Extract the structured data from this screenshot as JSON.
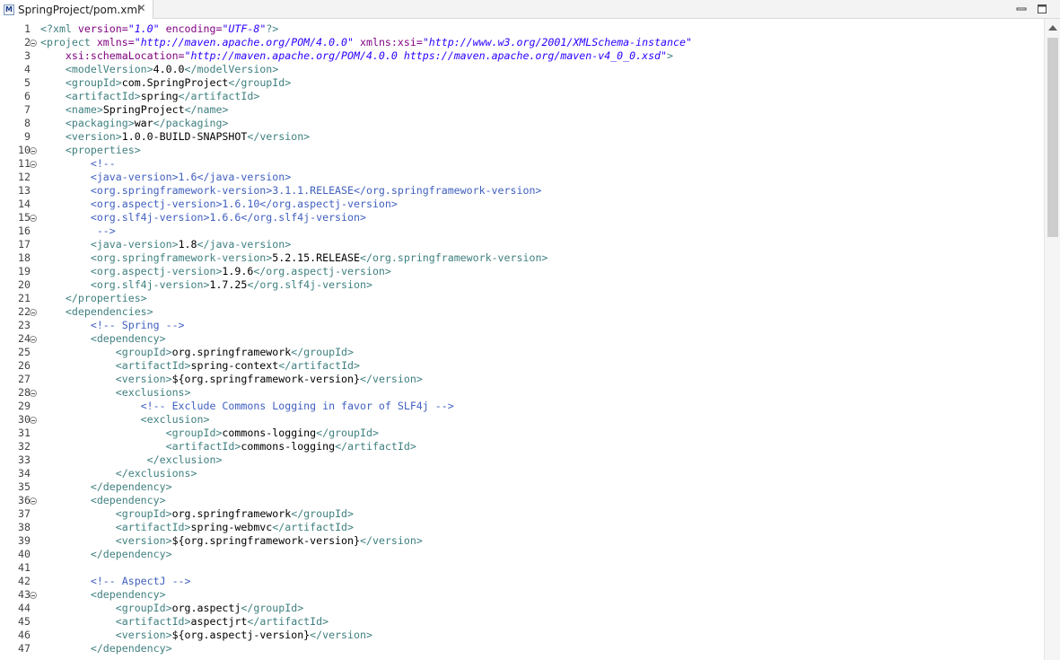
{
  "tab": {
    "title": "SpringProject/pom.xml",
    "icon": "maven-file-icon",
    "icon_text": "M"
  },
  "window_controls": {
    "minimize": "minimize-icon",
    "maximize": "maximize-icon"
  },
  "editor": {
    "lines": [
      {
        "n": 1,
        "segs": [
          [
            "t",
            "<?xml "
          ],
          [
            "a",
            "version="
          ],
          [
            "v",
            "\"1.0\""
          ],
          [
            "a",
            " encoding="
          ],
          [
            "v",
            "\"UTF-8\""
          ],
          [
            "t",
            "?>"
          ]
        ]
      },
      {
        "n": 2,
        "fold": true,
        "segs": [
          [
            "t",
            "<project "
          ],
          [
            "a",
            "xmlns="
          ],
          [
            "v",
            "\"http://maven.apache.org/POM/4.0.0\""
          ],
          [
            "a",
            " xmlns:xsi="
          ],
          [
            "v",
            "\"http://www.w3.org/2001/XMLSchema-instance\""
          ]
        ]
      },
      {
        "n": 3,
        "segs": [
          [
            "a",
            "    xsi:schemaLocation="
          ],
          [
            "v",
            "\"http://maven.apache.org/POM/4.0.0 https://maven.apache.org/maven-v4_0_0.xsd\""
          ],
          [
            "t",
            ">"
          ]
        ]
      },
      {
        "n": 4,
        "segs": [
          [
            "t",
            "    <modelVersion>"
          ],
          [
            "x",
            "4.0.0"
          ],
          [
            "t",
            "</modelVersion>"
          ]
        ]
      },
      {
        "n": 5,
        "segs": [
          [
            "t",
            "    <groupId>"
          ],
          [
            "x",
            "com.SpringProject"
          ],
          [
            "t",
            "</groupId>"
          ]
        ]
      },
      {
        "n": 6,
        "segs": [
          [
            "t",
            "    <artifactId>"
          ],
          [
            "x",
            "spring"
          ],
          [
            "t",
            "</artifactId>"
          ]
        ]
      },
      {
        "n": 7,
        "segs": [
          [
            "t",
            "    <name>"
          ],
          [
            "x",
            "SpringProject"
          ],
          [
            "t",
            "</name>"
          ]
        ]
      },
      {
        "n": 8,
        "segs": [
          [
            "t",
            "    <packaging>"
          ],
          [
            "x",
            "war"
          ],
          [
            "t",
            "</packaging>"
          ]
        ]
      },
      {
        "n": 9,
        "segs": [
          [
            "t",
            "    <version>"
          ],
          [
            "x",
            "1.0.0-BUILD-SNAPSHOT"
          ],
          [
            "t",
            "</version>"
          ]
        ]
      },
      {
        "n": 10,
        "fold": true,
        "segs": [
          [
            "t",
            "    <properties>"
          ]
        ]
      },
      {
        "n": 11,
        "fold": true,
        "segs": [
          [
            "c",
            "        <!--"
          ]
        ]
      },
      {
        "n": 12,
        "segs": [
          [
            "c",
            "        <java-version>1.6</java-version>"
          ]
        ]
      },
      {
        "n": 13,
        "segs": [
          [
            "c",
            "        <org.springframework-version>3.1.1.RELEASE</org.springframework-version>"
          ]
        ]
      },
      {
        "n": 14,
        "segs": [
          [
            "c",
            "        <org.aspectj-version>1.6.10</org.aspectj-version>"
          ]
        ]
      },
      {
        "n": 15,
        "fold": true,
        "segs": [
          [
            "c",
            "        <org.slf4j-version>1.6.6</org.slf4j-version>"
          ]
        ]
      },
      {
        "n": 16,
        "segs": [
          [
            "c",
            "         -->"
          ]
        ]
      },
      {
        "n": 17,
        "segs": [
          [
            "t",
            "        <java-version>"
          ],
          [
            "x",
            "1.8"
          ],
          [
            "t",
            "</java-version>"
          ]
        ]
      },
      {
        "n": 18,
        "segs": [
          [
            "t",
            "        <org.springframework-version>"
          ],
          [
            "x",
            "5.2.15.RELEASE"
          ],
          [
            "t",
            "</org.springframework-version>"
          ]
        ]
      },
      {
        "n": 19,
        "segs": [
          [
            "t",
            "        <org.aspectj-version>"
          ],
          [
            "x",
            "1.9.6"
          ],
          [
            "t",
            "</org.aspectj-version>"
          ]
        ]
      },
      {
        "n": 20,
        "segs": [
          [
            "t",
            "        <org.slf4j-version>"
          ],
          [
            "x",
            "1.7.25"
          ],
          [
            "t",
            "</org.slf4j-version>"
          ]
        ]
      },
      {
        "n": 21,
        "segs": [
          [
            "t",
            "    </properties>"
          ]
        ]
      },
      {
        "n": 22,
        "fold": true,
        "segs": [
          [
            "t",
            "    <dependencies>"
          ]
        ]
      },
      {
        "n": 23,
        "segs": [
          [
            "c",
            "        <!-- Spring -->"
          ]
        ]
      },
      {
        "n": 24,
        "fold": true,
        "segs": [
          [
            "t",
            "        <dependency>"
          ]
        ]
      },
      {
        "n": 25,
        "segs": [
          [
            "t",
            "            <groupId>"
          ],
          [
            "x",
            "org.springframework"
          ],
          [
            "t",
            "</groupId>"
          ]
        ]
      },
      {
        "n": 26,
        "segs": [
          [
            "t",
            "            <artifactId>"
          ],
          [
            "x",
            "spring-context"
          ],
          [
            "t",
            "</artifactId>"
          ]
        ]
      },
      {
        "n": 27,
        "segs": [
          [
            "t",
            "            <version>"
          ],
          [
            "x",
            "${org.springframework-version}"
          ],
          [
            "t",
            "</version>"
          ]
        ]
      },
      {
        "n": 28,
        "fold": true,
        "segs": [
          [
            "t",
            "            <exclusions>"
          ]
        ]
      },
      {
        "n": 29,
        "segs": [
          [
            "c",
            "                <!-- Exclude Commons Logging in favor of SLF4j -->"
          ]
        ]
      },
      {
        "n": 30,
        "fold": true,
        "segs": [
          [
            "t",
            "                <exclusion>"
          ]
        ]
      },
      {
        "n": 31,
        "segs": [
          [
            "t",
            "                    <groupId>"
          ],
          [
            "x",
            "commons-logging"
          ],
          [
            "t",
            "</groupId>"
          ]
        ]
      },
      {
        "n": 32,
        "segs": [
          [
            "t",
            "                    <artifactId>"
          ],
          [
            "x",
            "commons-logging"
          ],
          [
            "t",
            "</artifactId>"
          ]
        ]
      },
      {
        "n": 33,
        "segs": [
          [
            "t",
            "                 </exclusion>"
          ]
        ]
      },
      {
        "n": 34,
        "segs": [
          [
            "t",
            "            </exclusions>"
          ]
        ]
      },
      {
        "n": 35,
        "segs": [
          [
            "t",
            "        </dependency>"
          ]
        ]
      },
      {
        "n": 36,
        "fold": true,
        "segs": [
          [
            "t",
            "        <dependency>"
          ]
        ]
      },
      {
        "n": 37,
        "segs": [
          [
            "t",
            "            <groupId>"
          ],
          [
            "x",
            "org.springframework"
          ],
          [
            "t",
            "</groupId>"
          ]
        ]
      },
      {
        "n": 38,
        "segs": [
          [
            "t",
            "            <artifactId>"
          ],
          [
            "x",
            "spring-webmvc"
          ],
          [
            "t",
            "</artifactId>"
          ]
        ]
      },
      {
        "n": 39,
        "segs": [
          [
            "t",
            "            <version>"
          ],
          [
            "x",
            "${org.springframework-version}"
          ],
          [
            "t",
            "</version>"
          ]
        ]
      },
      {
        "n": 40,
        "segs": [
          [
            "t",
            "        </dependency>"
          ]
        ]
      },
      {
        "n": 41,
        "segs": []
      },
      {
        "n": 42,
        "segs": [
          [
            "c",
            "        <!-- AspectJ -->"
          ]
        ]
      },
      {
        "n": 43,
        "fold": true,
        "segs": [
          [
            "t",
            "        <dependency>"
          ]
        ]
      },
      {
        "n": 44,
        "segs": [
          [
            "t",
            "            <groupId>"
          ],
          [
            "x",
            "org.aspectj"
          ],
          [
            "t",
            "</groupId>"
          ]
        ]
      },
      {
        "n": 45,
        "segs": [
          [
            "t",
            "            <artifactId>"
          ],
          [
            "x",
            "aspectjrt"
          ],
          [
            "t",
            "</artifactId>"
          ]
        ]
      },
      {
        "n": 46,
        "segs": [
          [
            "t",
            "            <version>"
          ],
          [
            "x",
            "${org.aspectj-version}"
          ],
          [
            "t",
            "</version>"
          ]
        ]
      },
      {
        "n": 47,
        "segs": [
          [
            "t",
            "        </dependency>"
          ]
        ]
      }
    ]
  },
  "colors": {
    "tag": "#3f7f7f",
    "attribute": "#7f007f",
    "attribute_value": "#2a00ff",
    "comment": "#3f5fbf",
    "text": "#000000"
  }
}
